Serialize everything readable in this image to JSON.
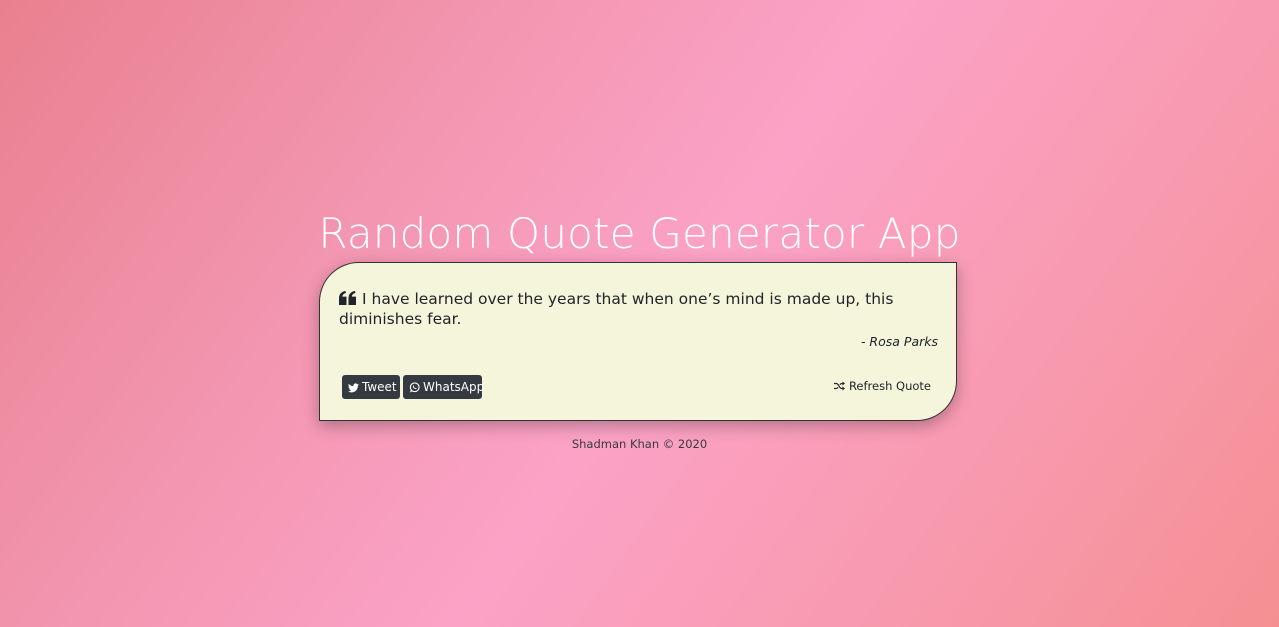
{
  "app": {
    "title": "Random Quote Generator App"
  },
  "quote": {
    "text": "I have learned over the years that when one’s mind is made up, this diminishes fear.",
    "author": "- Rosa Parks",
    "icon": "quote-left-icon"
  },
  "actions": {
    "tweet_label": "Tweet",
    "tweet_icon": "twitter-icon",
    "whatsapp_label": "WhatsApp",
    "whatsapp_icon": "whatsapp-icon",
    "refresh_label": "Refresh Quote",
    "refresh_icon": "shuffle-icon"
  },
  "footer": {
    "text": "Shadman Khan © 2020"
  },
  "colors": {
    "card_background": "#f5f5dc",
    "button_background": "#343a40",
    "title_color": "#ffffff"
  }
}
